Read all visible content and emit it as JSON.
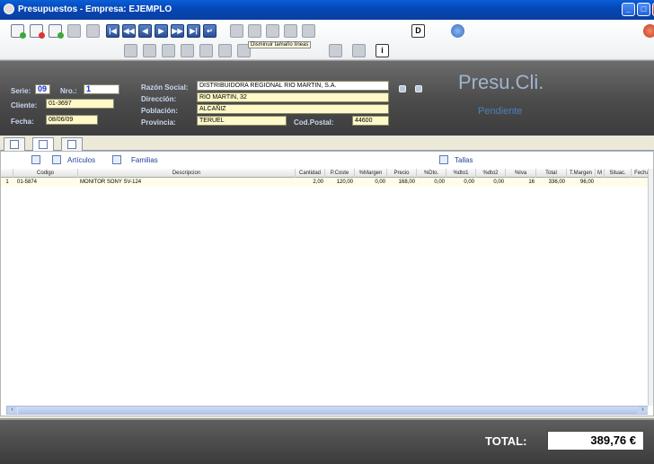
{
  "window": {
    "title": "Presupuestos - Empresa: EJEMPLO"
  },
  "toolbar": {
    "tooltip": "Disminuir tamaño líneas",
    "help_letter": "D",
    "info_letter": "i"
  },
  "header": {
    "serie_label": "Serie:",
    "serie_value": "09",
    "nro_label": "Nro.:",
    "nro_value": "1",
    "cliente_label": "Cliente:",
    "cliente_value": "01-3697",
    "fecha_label": "Fecha:",
    "fecha_value": "08/06/09",
    "razon_label": "Razón Social:",
    "razon_value": "DISTRIBUIDORA REGIONAL RIO MARTIN, S.A.",
    "direccion_label": "Dirección:",
    "direccion_value": "RIO MARTIN, 32",
    "poblacion_label": "Población:",
    "poblacion_value": "ALCAÑIZ",
    "provincia_label": "Provincia:",
    "provincia_value": "TERUEL",
    "cp_label": "Cod.Postal:",
    "cp_value": "44600",
    "big_title": "Presu.Cli.",
    "status": "Pendiente"
  },
  "grid": {
    "articulos_label": "Artículos",
    "familias_label": "Familias",
    "tallas_label": "Tallas",
    "columns": [
      "Codigo",
      "Descripcion",
      "Cantidad",
      "P.Coste",
      "%Margen",
      "Precio",
      "%Dto.",
      "%dto1",
      "%dto2",
      "%Iva",
      "Total",
      "T.Margen",
      "M",
      "Situac.",
      "Fecha"
    ],
    "rows": [
      {
        "num": "1",
        "codigo": "01-5874",
        "descripcion": "MONITOR SONY SV-124",
        "cantidad": "2,00",
        "pcoste": "120,00",
        "margen": "0,00",
        "precio": "168,00",
        "dto": "0,00",
        "dto1": "0,00",
        "dto2": "0,00",
        "iva": "16",
        "total": "336,00",
        "tmargen": "96,00",
        "m": "",
        "situac": "",
        "fecha": ""
      }
    ]
  },
  "footer": {
    "total_label": "TOTAL:",
    "total_value": "389,76 €"
  },
  "colors": {
    "titlebar": "#0548b8",
    "header_bg": "#4a4a4a",
    "field_bg": "#fff9c8",
    "accent_title": "#9fb4cf",
    "status_color": "#4b80bf"
  }
}
